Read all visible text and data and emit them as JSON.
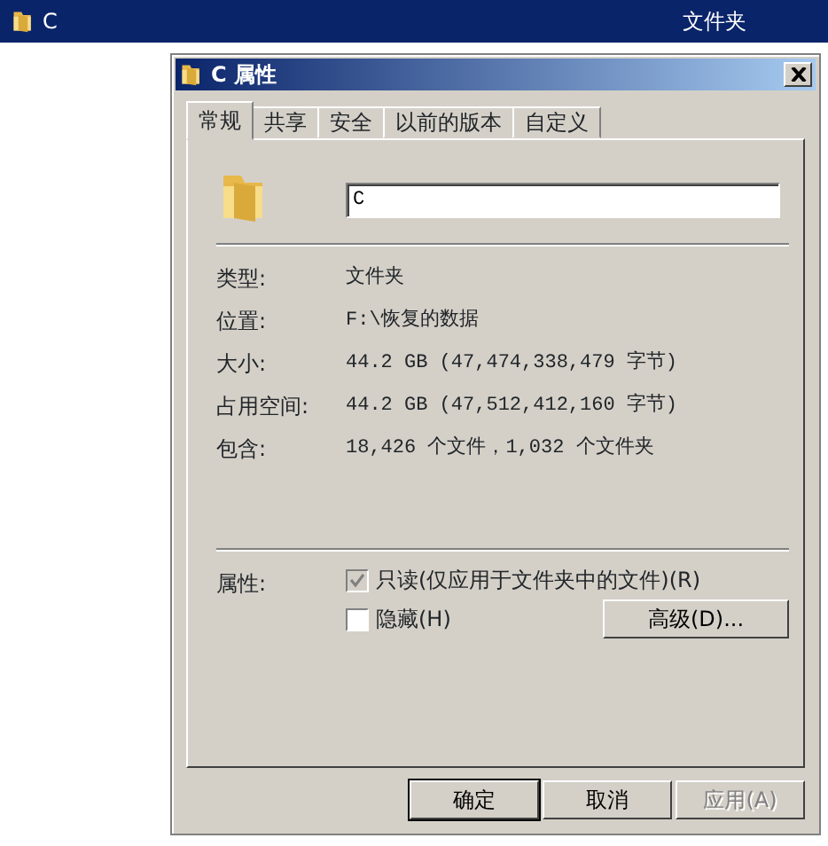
{
  "explorer_row": {
    "name": "C",
    "type": "文件夹",
    "selected": true
  },
  "dialog": {
    "title": "C 属性",
    "tabs": [
      {
        "label": "常规",
        "selected": true
      },
      {
        "label": "共享",
        "selected": false
      },
      {
        "label": "安全",
        "selected": false
      },
      {
        "label": "以前的版本",
        "selected": false
      },
      {
        "label": "自定义",
        "selected": false
      }
    ],
    "name_field": {
      "value": "C"
    },
    "properties": [
      {
        "label": "类型:",
        "value": "文件夹"
      },
      {
        "label": "位置:",
        "value": "F:\\恢复的数据"
      },
      {
        "label": "大小:",
        "value": "44.2 GB (47,474,338,479 字节)"
      },
      {
        "label": "占用空间:",
        "value": "44.2 GB (47,512,412,160 字节)"
      },
      {
        "label": "包含:",
        "value": "18,426 个文件，1,032 个文件夹"
      }
    ],
    "attributes": {
      "label": "属性:",
      "checkboxes": [
        {
          "label": "只读(仅应用于文件夹中的文件)(R)",
          "checked": true,
          "greyed": true
        },
        {
          "label": "隐藏(H)",
          "checked": false,
          "greyed": false
        }
      ],
      "advanced_button": "高级(D)..."
    },
    "buttons": [
      {
        "label": "确定",
        "default": true,
        "disabled": false
      },
      {
        "label": "取消",
        "default": false,
        "disabled": false
      },
      {
        "label": "应用(A)",
        "default": false,
        "disabled": true
      }
    ]
  }
}
